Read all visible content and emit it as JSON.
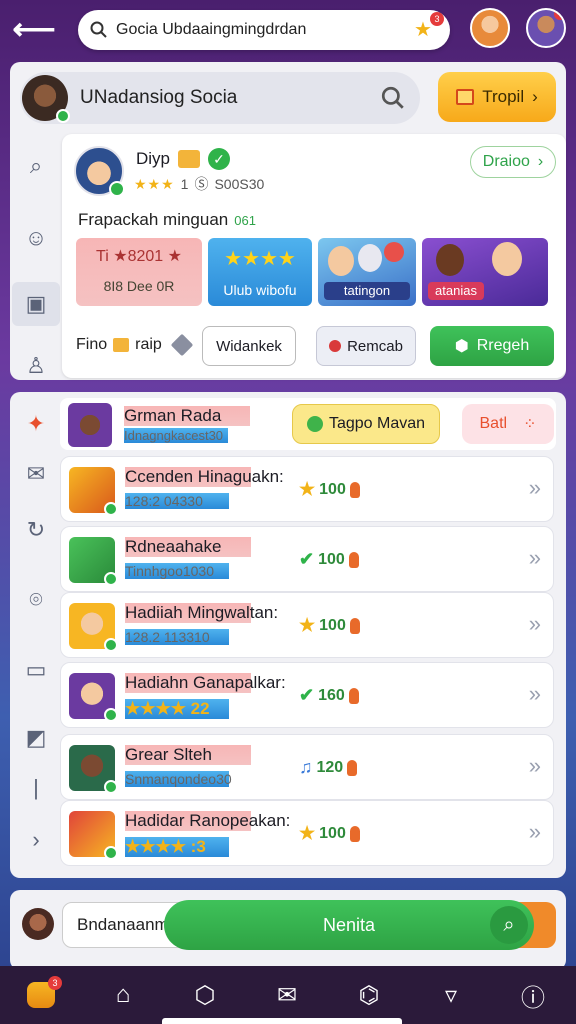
{
  "topbar": {
    "search_query": "Gocia Ubdaaingmingdrdan",
    "star_badge": "3"
  },
  "user_bar": {
    "name": "UNadansiog Socia",
    "tropi_label": "Tropil"
  },
  "profile_card": {
    "username": "Diyp",
    "rating_text": "1",
    "score": "S00S30",
    "link_label": "Draioo",
    "section_title": "Frapackah minguan",
    "section_count": "061",
    "tiles": [
      {
        "top": "Ti ★8201 ★",
        "bottom": "8I8 Dee 0R"
      },
      {
        "top": "★★★★",
        "bottom": "Ulub wibofu"
      },
      {
        "top": "",
        "bottom": "tatingon"
      },
      {
        "top": "",
        "bottom": "atanias"
      }
    ],
    "actions": {
      "label": "Fino",
      "label2": "raip",
      "withdraw": "Widankek",
      "remove": "Remcab",
      "register": "Rregeh"
    }
  },
  "list_panel": {
    "header_title": "Grman Rada",
    "header_sub": "Idnagngkacest30",
    "tag_label": "Tagpo Mavan",
    "bat_label": "Batl",
    "rows": [
      {
        "title": "Ccenden Hinaguakn:",
        "sub": "128:2 04330",
        "points": "100",
        "icon": "star-icon",
        "stars": ""
      },
      {
        "title": "Rdneaahake",
        "sub": "Tinnhgoo1030",
        "points": "100",
        "icon": "check-icon",
        "stars": ""
      },
      {
        "title": "Hadiiah Mingwaltan:",
        "sub": "128.2 113310",
        "points": "100",
        "icon": "star-icon",
        "stars": ""
      },
      {
        "title": "Hadiahn Ganapalkar:",
        "sub": "",
        "points": "160",
        "icon": "check-icon",
        "stars": "★★★★ 22"
      },
      {
        "title": "Grear Slteh",
        "sub": "Snmanqondeo30",
        "points": "120",
        "icon": "note-icon",
        "stars": ""
      },
      {
        "title": "Hadidar Ranopeakan:",
        "sub": "",
        "points": "100",
        "icon": "star-icon",
        "stars": "★★★★ :3"
      }
    ]
  },
  "bottom": {
    "input_value": "Bndanaanm",
    "search_label": "Nenita"
  },
  "nav": {
    "badge": "3"
  },
  "colors": {
    "accent_green": "#2ea344",
    "accent_orange": "#f7a91a",
    "background_top": "#4a1f6e",
    "background_bottom": "#2a3f8a"
  }
}
